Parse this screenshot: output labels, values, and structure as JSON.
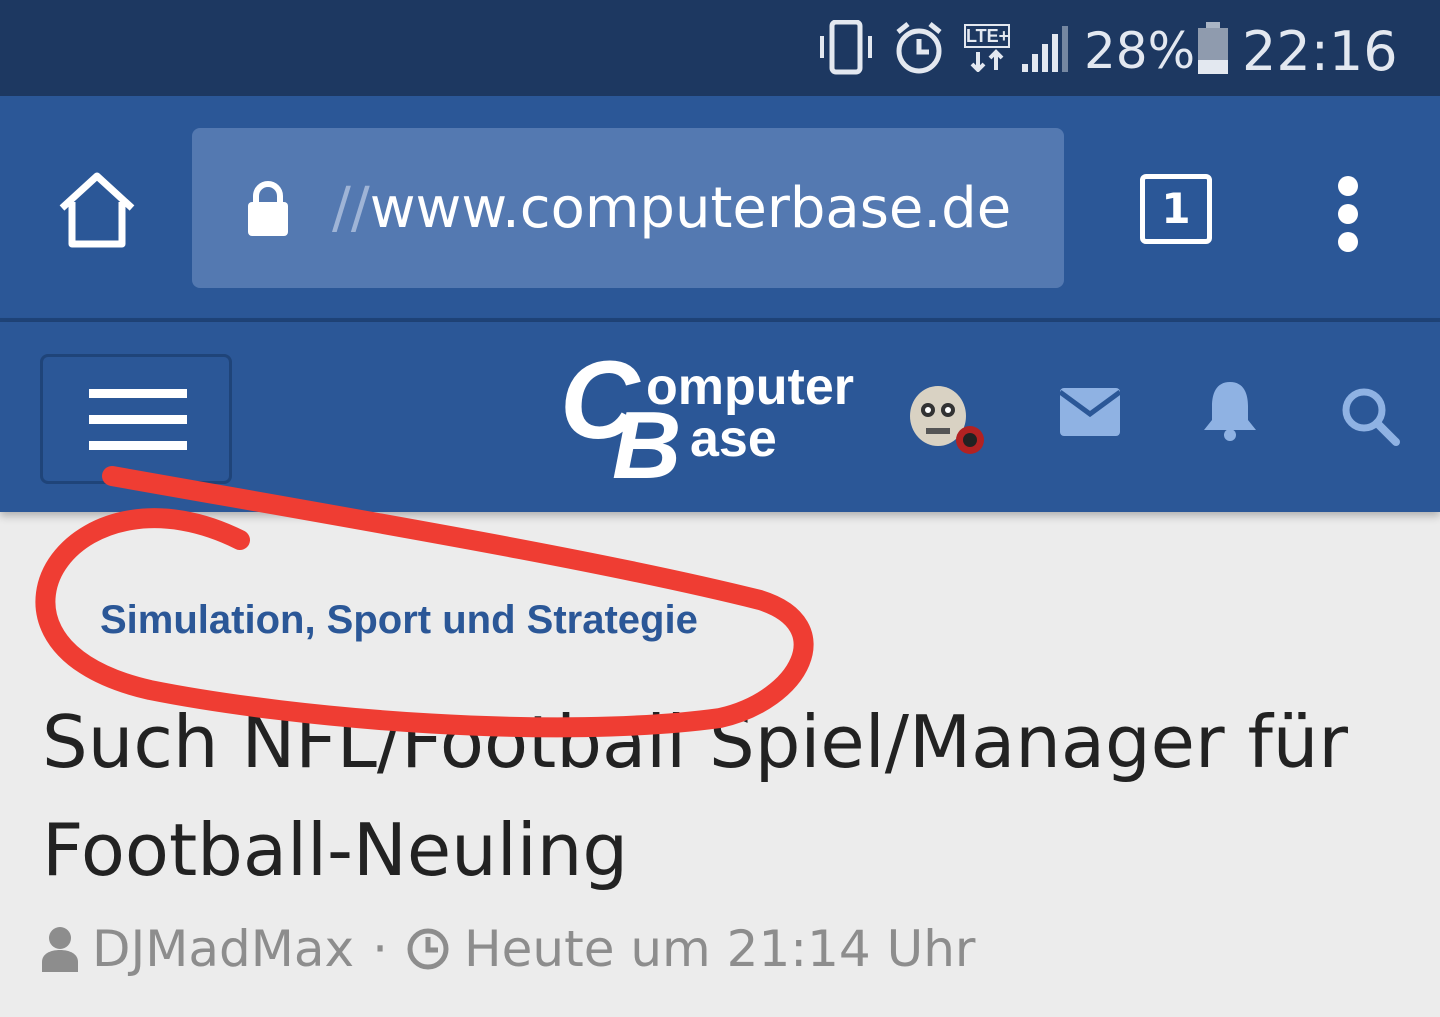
{
  "status_bar": {
    "icons": [
      "vibrate-icon",
      "alarm-icon",
      "lte-icon",
      "signal-icon",
      "battery-icon"
    ],
    "network_label": "LTE+",
    "battery": "28%",
    "time": "22:16"
  },
  "browser": {
    "url_scheme": "//",
    "url_host": "www.computerbase.de",
    "tab_count": "1",
    "icons": [
      "home-icon",
      "lock-icon",
      "tabs-icon",
      "overflow-menu-icon"
    ]
  },
  "site_header": {
    "logo_text": "ComputerBase",
    "icons": [
      "hamburger-menu-icon",
      "avatar",
      "mail-icon",
      "bell-icon",
      "search-icon"
    ]
  },
  "thread": {
    "category": "Simulation, Sport und Strategie",
    "title": "Such NFL/Football Spiel/Manager für Football-Neuling",
    "author": "DJMadMax",
    "separator": "·",
    "timestamp": "Heute um 21:14 Uhr"
  },
  "colors": {
    "status_bar": "#1d3861",
    "brand_blue": "#2b5797",
    "url_field": "#5479b1",
    "page_bg": "#ececec",
    "annotation_red": "#ef3d33"
  }
}
